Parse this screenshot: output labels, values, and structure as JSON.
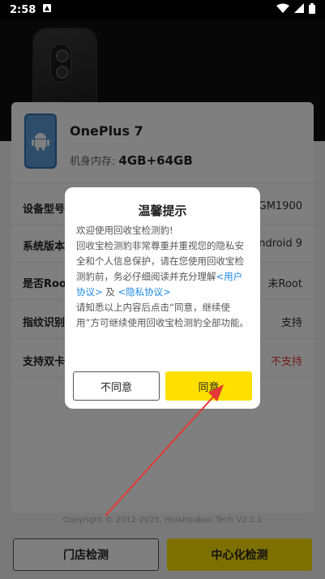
{
  "status_bar": {
    "time": "2:58"
  },
  "device": {
    "name": "OnePlus 7",
    "memory_label": "机身内存:",
    "memory_value": "4GB+64GB"
  },
  "specs": [
    {
      "label": "设备型号",
      "value": "GM1900"
    },
    {
      "label": "系统版本",
      "value": "Android 9"
    },
    {
      "label": "是否Root",
      "value": "未Root"
    },
    {
      "label": "指纹识别",
      "value": "支持"
    },
    {
      "label": "支持双卡",
      "value": "不支持",
      "color": "#e53935"
    }
  ],
  "copyright": "Copyright © 2012-2025, Huishoubao Tech V2.2.1",
  "buttons": {
    "store": "门店检测",
    "center": "中心化检测"
  },
  "dialog": {
    "title": "温馨提示",
    "p1": "欢迎使用回收宝检测豹!",
    "p2": "回收宝检测豹非常尊重并重视您的隐私安全和个人信息保护，请在您使用回收宝检测豹前，务必仔细阅读并充分理解",
    "link_user": "<用户协议>",
    "and": " 及 ",
    "link_privacy": "<隐私协议>",
    "p3": "请知悉以上内容后点击“同意，继续使用”方可继续使用回收宝检测豹全部功能。",
    "cancel": "不同意",
    "ok": "同意"
  },
  "colors": {
    "accent": "#fde000",
    "link": "#1e88e5",
    "arrow": "#e53935"
  }
}
